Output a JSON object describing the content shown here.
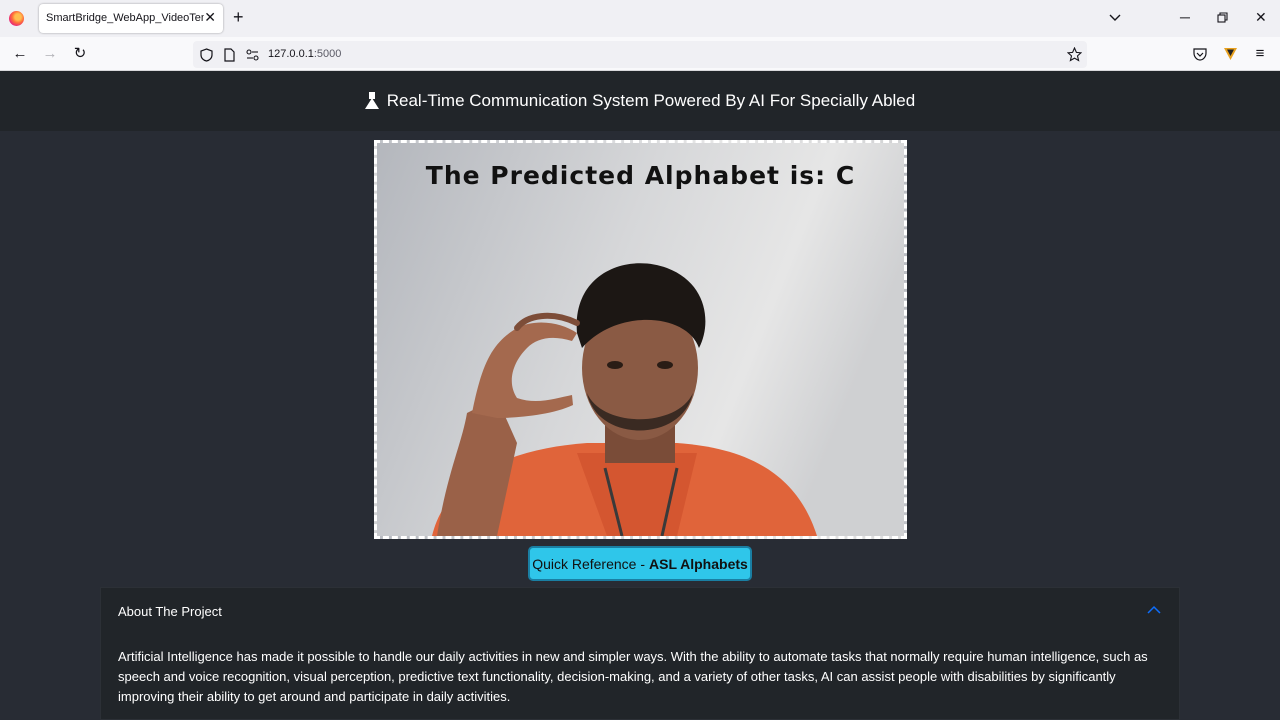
{
  "browser": {
    "tab_title": "SmartBridge_WebApp_VideoTemplate",
    "url_host": "127.0.0.1",
    "url_port": ":5000"
  },
  "header": {
    "title": "Real-Time Communication System Powered By AI For Specially Abled"
  },
  "video": {
    "prediction_text": "The Predicted Alphabet is: C"
  },
  "reference_button": {
    "prefix": "Quick Reference - ",
    "bold": "ASL Alphabets"
  },
  "about": {
    "title": "About The Project",
    "body": "Artificial Intelligence has made it possible to handle our daily activities in new and simpler ways. With the ability to automate tasks that normally require human intelligence, such as speech and voice recognition, visual perception, predictive text functionality, decision-making, and a variety of other tasks, AI can assist people with disabilities by significantly improving their ability to get around and participate in daily activities."
  },
  "colors": {
    "page_bg": "#282c34",
    "header_bg": "#212529",
    "button_bg": "#2fc6ea",
    "accordion_chevron": "#0d6efd"
  }
}
